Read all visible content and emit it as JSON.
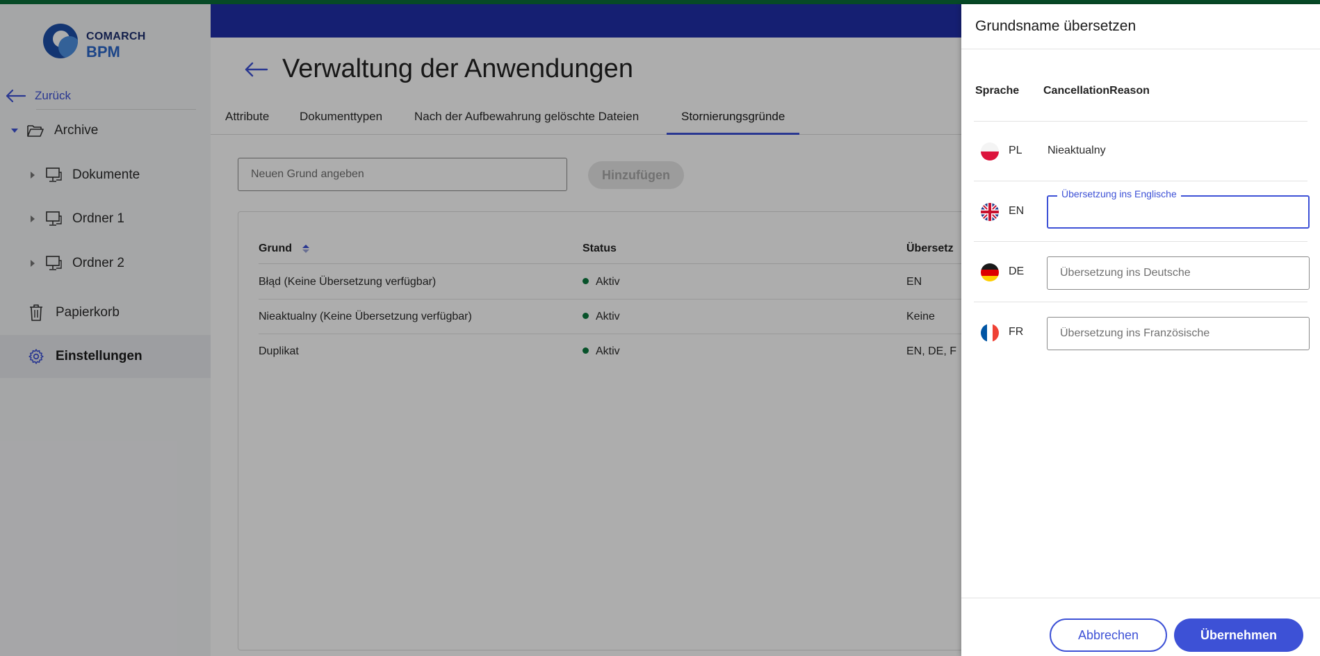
{
  "brand": {
    "line1": "COMARCH",
    "line2": "BPM"
  },
  "sidebar": {
    "back_label": "Zurück",
    "tree": {
      "root": "Archive",
      "children": [
        "Dokumente",
        "Ordner 1",
        "Ordner 2"
      ]
    },
    "items": [
      {
        "label": "Papierkorb"
      },
      {
        "label": "Einstellungen",
        "active": true
      }
    ]
  },
  "main": {
    "title": "Verwaltung der Anwendungen",
    "tabs": [
      {
        "label": "Attribute"
      },
      {
        "label": "Dokumenttypen"
      },
      {
        "label": "Nach der Aufbewahrung gelöschte Dateien"
      },
      {
        "label": "Stornierungsgründe",
        "active": true
      }
    ],
    "new_reason_placeholder": "Neuen Grund angeben",
    "add_button": "Hinzufügen",
    "table": {
      "columns": [
        "Grund",
        "Status",
        "Übersetz"
      ],
      "rows": [
        {
          "reason": "Błąd (Keine Übersetzung verfügbar)",
          "status": "Aktiv",
          "translations": "EN"
        },
        {
          "reason": "Nieaktualny (Keine Übersetzung verfügbar)",
          "status": "Aktiv",
          "translations": "Keine"
        },
        {
          "reason": "Duplikat",
          "status": "Aktiv",
          "translations": "EN, DE, F"
        }
      ]
    }
  },
  "drawer": {
    "title": "Grundsname übersetzen",
    "col_language": "Sprache",
    "col_key": "CancellationReason",
    "rows": [
      {
        "code": "PL",
        "value": "Nieaktualny"
      },
      {
        "code": "EN",
        "label": "Übersetzung ins Englische",
        "value": ""
      },
      {
        "code": "DE",
        "placeholder": "Übersetzung ins Deutsche"
      },
      {
        "code": "FR",
        "placeholder": "Übersetzung ins Französische"
      }
    ],
    "cancel_button": "Abbrechen",
    "apply_button": "Übernehmen"
  },
  "colors": {
    "accent": "#3d51d6",
    "banner": "#1f2fa8",
    "status_active": "#0b7a3e",
    "top_line": "#0b6e3a"
  }
}
